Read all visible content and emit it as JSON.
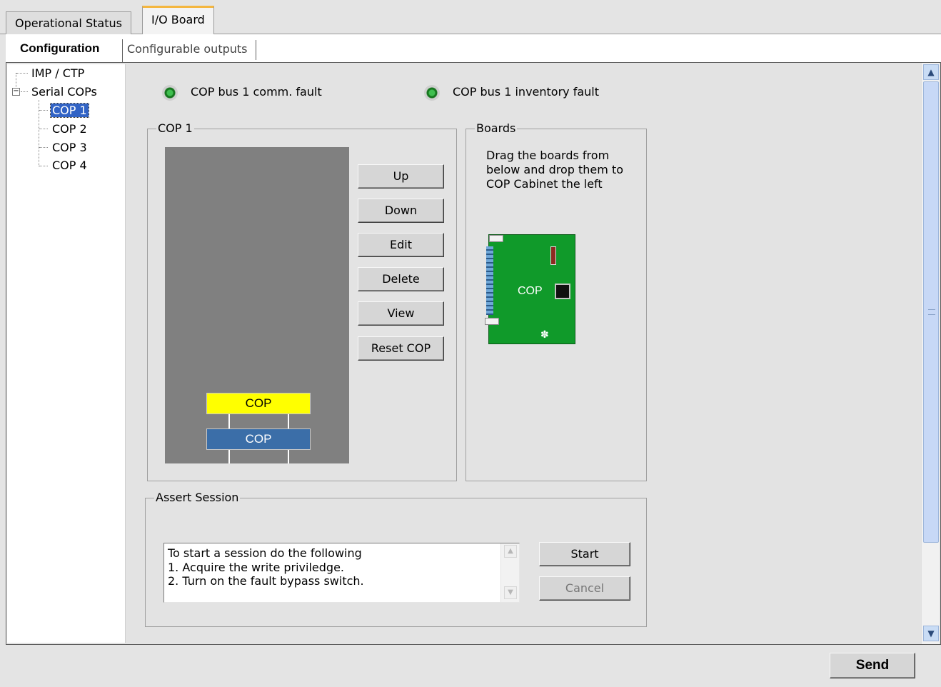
{
  "tabs": {
    "top": [
      {
        "label": "Operational Status",
        "active": false
      },
      {
        "label": "I/O Board",
        "active": true
      }
    ],
    "sub": [
      {
        "label": "Configuration",
        "active": true
      },
      {
        "label": "Configurable outputs",
        "active": false
      }
    ]
  },
  "tree": {
    "items": [
      {
        "label": "IMP / CTP"
      },
      {
        "label": "Serial COPs",
        "expander": "−"
      },
      {
        "label": "COP 1",
        "selected": true
      },
      {
        "label": "COP 2"
      },
      {
        "label": "COP 3"
      },
      {
        "label": "COP 4"
      }
    ]
  },
  "status": {
    "bus_comm_fault": "COP bus 1 comm. fault",
    "bus_inventory_fault": "COP bus 1 inventory fault",
    "led_color": "#2fae3a"
  },
  "cop_group": {
    "title": "COP 1",
    "slots": [
      {
        "label": "COP",
        "color": "#ffff00"
      },
      {
        "label": "COP",
        "color": "#3b6ea8"
      }
    ],
    "buttons": {
      "up": "Up",
      "down": "Down",
      "edit": "Edit",
      "delete": "Delete",
      "view": "View",
      "reset": "Reset COP"
    }
  },
  "boards_group": {
    "title": "Boards",
    "instructions": "Drag the boards from below and drop them to COP Cabinet the left",
    "board_label": "COP"
  },
  "assert_session": {
    "title": "Assert Session",
    "text_lines": [
      "To start a session do the following",
      "1. Acquire the write priviledge.",
      "2. Turn on the fault bypass switch."
    ],
    "start_label": "Start",
    "cancel_label": "Cancel"
  },
  "footer": {
    "send_label": "Send"
  }
}
